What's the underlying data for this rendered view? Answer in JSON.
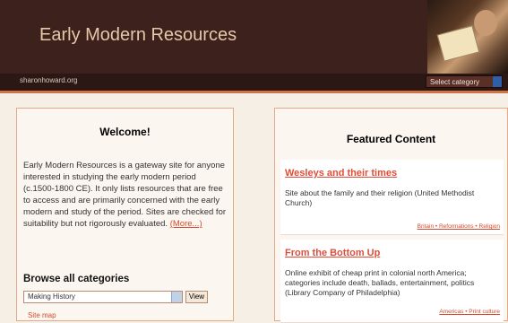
{
  "header": {
    "title": "Early Modern Resources",
    "domain": "sharonhoward.org",
    "category_select": "Select category"
  },
  "welcome": {
    "title": "Welcome!",
    "intro": "Early Modern Resources is a gateway site for anyone interested in studying the early modern period (c.1500-1800 CE). It only lists resources that are free to access and are primarily concerned with the early modern and study of the period. Sites are checked for suitability but not rigorously evaluated.",
    "more": "(More...)"
  },
  "browse": {
    "title": "Browse all categories",
    "selected": "Making History",
    "view": "View",
    "sitemap": "Site map"
  },
  "featured": {
    "title": "Featured Content",
    "items": [
      {
        "title": "Wesleys and their times",
        "description": "Site about the family and their religion (United Methodist Church)",
        "tags": "Britain • Reformations • Religion"
      },
      {
        "title": "From the Bottom Up",
        "description": "Online exhibit of cheap print in colonial north America; categories include death, ballads, entertainment, politics (Library Company of Philadelphia)",
        "tags": "Americas • Print culture"
      }
    ]
  }
}
